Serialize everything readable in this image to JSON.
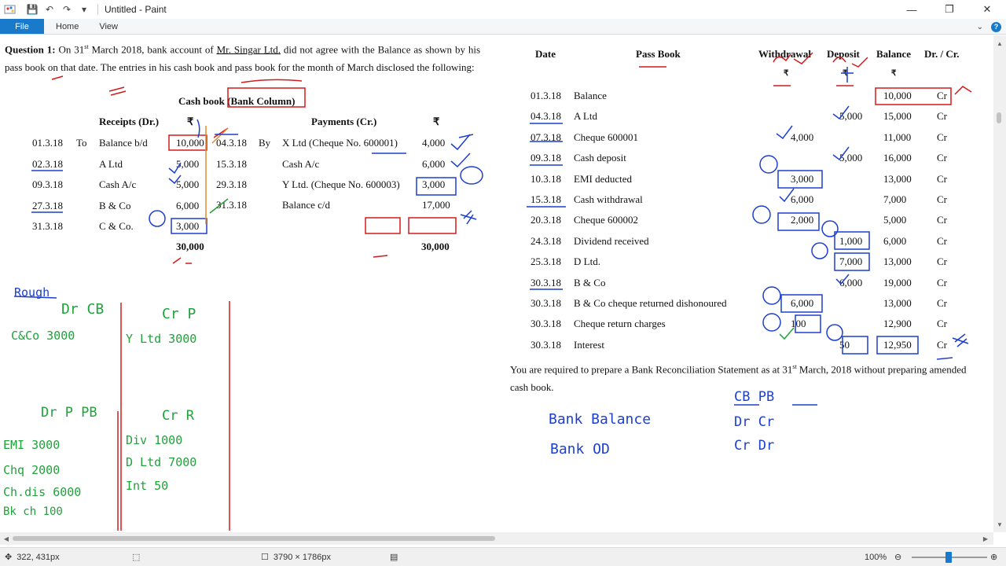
{
  "window": {
    "title": "Untitled - Paint",
    "controls": {
      "minimize": "—",
      "restore": "❐",
      "close": "✕"
    }
  },
  "quick_access": {
    "save": "💾",
    "undo": "↶",
    "redo": "↷",
    "customize": "▾"
  },
  "ribbon": {
    "tabs": [
      "File",
      "Home",
      "View"
    ],
    "collapse": "⌄",
    "help": "?"
  },
  "question": {
    "label": "Question 1:",
    "text_a": " On 31",
    "sup": "st",
    "text_b": " March 2018, bank account of ",
    "company": "Mr. Singar Ltd.",
    "text_c": " did not agree with the Balance as shown by his pass book on that date. The entries in his cash book and pass book for the month of March disclosed the following:"
  },
  "cashbook": {
    "title": "Cash book (Bank Column)",
    "receipts_header": "Receipts (Dr.)",
    "payments_header": "Payments (Cr.)",
    "rupee": "₹",
    "receipts": [
      {
        "date": "01.3.18",
        "to": "To",
        "particular": "Balance b/d",
        "amount": "10,000"
      },
      {
        "date": "02.3.18",
        "to": "",
        "particular": "A Ltd",
        "amount": "5,000"
      },
      {
        "date": "09.3.18",
        "to": "",
        "particular": "Cash A/c",
        "amount": "5,000"
      },
      {
        "date": "27.3.18",
        "to": "",
        "particular": "B & Co",
        "amount": "6,000"
      },
      {
        "date": "31.3.18",
        "to": "",
        "particular": "C & Co.",
        "amount": "3,000"
      }
    ],
    "receipts_total": "30,000",
    "payments": [
      {
        "date": "04.3.18",
        "by": "By",
        "particular": "X Ltd (Cheque No. 600001)",
        "amount": "4,000"
      },
      {
        "date": "15.3.18",
        "by": "",
        "particular": "Cash A/c",
        "amount": "6,000"
      },
      {
        "date": "29.3.18",
        "by": "",
        "particular": "Y Ltd. (Cheque No. 600003)",
        "amount": "3,000"
      },
      {
        "date": "31.3.18",
        "by": "",
        "particular": "Balance c/d",
        "amount": "17,000"
      }
    ],
    "payments_total": "30,000"
  },
  "passbook": {
    "headers": {
      "date": "Date",
      "particular": "Pass Book",
      "withdrawal": "Withdrawal",
      "deposit": "Deposit",
      "balance": "Balance",
      "drcr": "Dr. / Cr."
    },
    "rupee": "₹",
    "rows": [
      {
        "date": "01.3.18",
        "particular": "Balance",
        "withdrawal": "",
        "deposit": "",
        "balance": "10,000",
        "drcr": "Cr"
      },
      {
        "date": "04.3.18",
        "particular": "A Ltd",
        "withdrawal": "",
        "deposit": "5,000",
        "balance": "15,000",
        "drcr": "Cr"
      },
      {
        "date": "07.3.18",
        "particular": "Cheque 600001",
        "withdrawal": "4,000",
        "deposit": "",
        "balance": "11,000",
        "drcr": "Cr"
      },
      {
        "date": "09.3.18",
        "particular": "Cash deposit",
        "withdrawal": "",
        "deposit": "5,000",
        "balance": "16,000",
        "drcr": "Cr"
      },
      {
        "date": "10.3.18",
        "particular": "EMI deducted",
        "withdrawal": "3,000",
        "deposit": "",
        "balance": "13,000",
        "drcr": "Cr"
      },
      {
        "date": "15.3.18",
        "particular": "Cash withdrawal",
        "withdrawal": "6,000",
        "deposit": "",
        "balance": "7,000",
        "drcr": "Cr"
      },
      {
        "date": "20.3.18",
        "particular": "Cheque 600002",
        "withdrawal": "2,000",
        "deposit": "",
        "balance": "5,000",
        "drcr": "Cr"
      },
      {
        "date": "24.3.18",
        "particular": "Dividend received",
        "withdrawal": "",
        "deposit": "1,000",
        "balance": "6,000",
        "drcr": "Cr"
      },
      {
        "date": "25.3.18",
        "particular": "D Ltd.",
        "withdrawal": "",
        "deposit": "7,000",
        "balance": "13,000",
        "drcr": "Cr"
      },
      {
        "date": "30.3.18",
        "particular": "B & Co",
        "withdrawal": "",
        "deposit": "6,000",
        "balance": "19,000",
        "drcr": "Cr"
      },
      {
        "date": "30.3.18",
        "particular": "B & Co cheque returned dishonoured",
        "withdrawal": "6,000",
        "deposit": "",
        "balance": "13,000",
        "drcr": "Cr"
      },
      {
        "date": "30.3.18",
        "particular": "Cheque return charges",
        "withdrawal": "100",
        "deposit": "",
        "balance": "12,900",
        "drcr": "Cr"
      },
      {
        "date": "30.3.18",
        "particular": "Interest",
        "withdrawal": "",
        "deposit": "50",
        "balance": "12,950",
        "drcr": "Cr"
      }
    ]
  },
  "instruction": {
    "a": "You are required to prepare a Bank Reconciliation Statement as at 31",
    "sup": "st",
    "b": " March, 2018 without preparing amended cash book."
  },
  "handwriting": {
    "rough": "Rough",
    "drcb": "Dr CB",
    "cr_p": "Cr P",
    "c_and_co": "C&Co 3000",
    "y_ltd": "Y Ltd 3000",
    "dr_p_pb": "Dr P  PB",
    "cr_r": "Cr R",
    "left_items": [
      "EMI 3000",
      "Chq 2000",
      "Ch.dis 6000",
      "Bk ch 100"
    ],
    "right_items": [
      "Div 1000",
      "D Ltd 7000",
      "Int 50"
    ],
    "bank_balance": "Bank Balance",
    "bank_od": "Bank OD",
    "cb_pb": "CB    PB",
    "dr_cr": "Dr    Cr",
    "cr_dr": "Cr    Dr"
  },
  "statusbar": {
    "cursor": "322, 431px",
    "dimensions": "3790 × 1786px",
    "zoom": "100%"
  },
  "colors": {
    "accent": "#1979ca",
    "ink_red": "#d31a1a",
    "ink_blue": "#1d3fd0",
    "ink_green": "#1fa33a"
  }
}
